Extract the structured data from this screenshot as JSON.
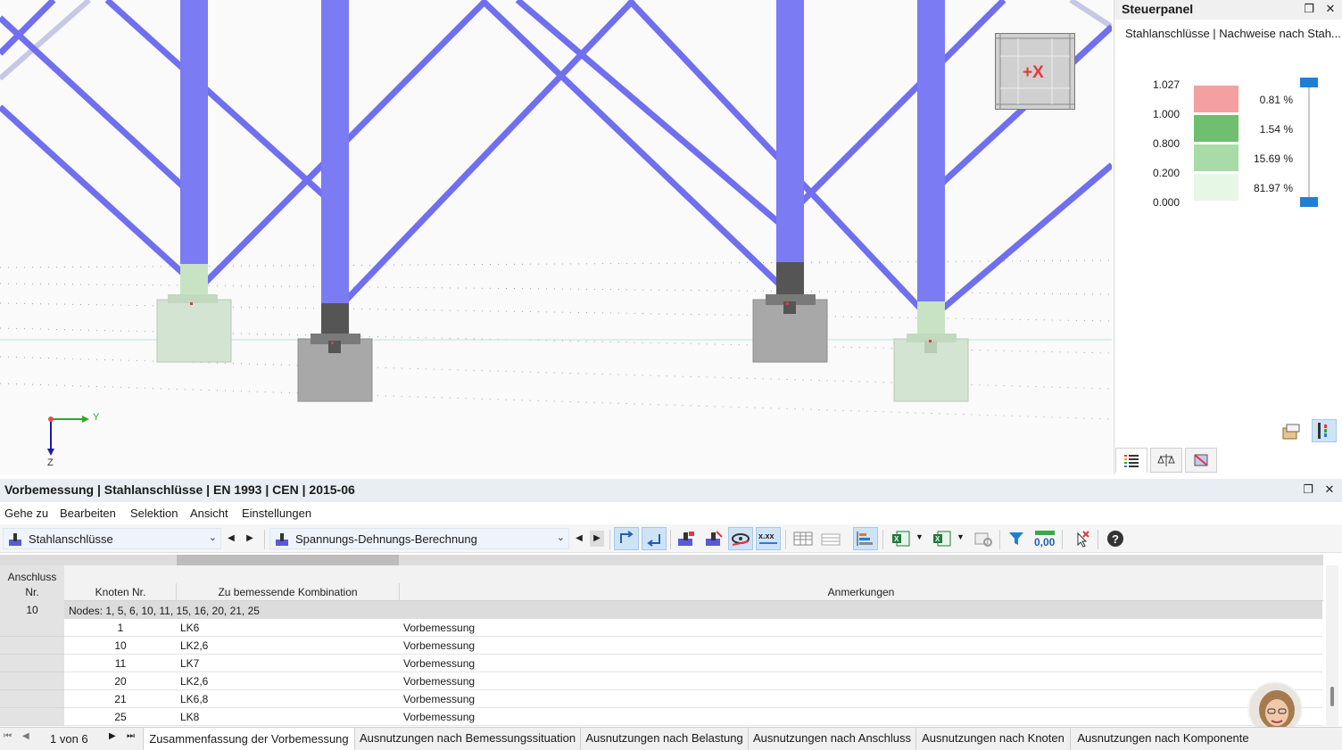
{
  "viewport": {
    "axis_y": "Y",
    "axis_z": "Z",
    "view_cube_label": "+X"
  },
  "panel": {
    "title": "Steuerpanel",
    "subtitle": "Stahlanschlüsse | Nachweise nach Stah...",
    "legend": {
      "values": [
        "1.027",
        "1.000",
        "0.800",
        "0.200",
        "0.000"
      ],
      "bands": [
        {
          "percent": "0.81 %",
          "color": "#f4a0a0"
        },
        {
          "percent": "1.54 %",
          "color": "#6fbf6f"
        },
        {
          "percent": "15.69 %",
          "color": "#a8dba8"
        },
        {
          "percent": "81.97 %",
          "color": "#e6f7e6"
        }
      ]
    }
  },
  "bottom": {
    "title": "Vorbemessung | Stahlanschlüsse | EN 1993 | CEN | 2015-06",
    "menu": [
      "Gehe zu",
      "Bearbeiten",
      "Selektion",
      "Ansicht",
      "Einstellungen"
    ],
    "combo1": "Stahlanschlüsse",
    "combo2": "Spannungs-Dehnungs-Berechnung",
    "table": {
      "headers": {
        "col1_line1": "Anschluss",
        "col1_line2": "Nr.",
        "col2": "Knoten Nr.",
        "col3": "Zu bemessende Kombination",
        "col4": "Anmerkungen"
      },
      "group": {
        "nr": "10",
        "nodes": "Nodes: 1, 5, 6, 10, 11, 15, 16, 20, 21, 25"
      },
      "rows": [
        {
          "node": "1",
          "combo": "LK6",
          "note": "Vorbemessung"
        },
        {
          "node": "10",
          "combo": "LK2,6",
          "note": "Vorbemessung"
        },
        {
          "node": "11",
          "combo": "LK7",
          "note": "Vorbemessung"
        },
        {
          "node": "20",
          "combo": "LK2,6",
          "note": "Vorbemessung"
        },
        {
          "node": "21",
          "combo": "LK6,8",
          "note": "Vorbemessung"
        },
        {
          "node": "25",
          "combo": "LK8",
          "note": "Vorbemessung"
        }
      ]
    },
    "pager": "1 von 6",
    "tabs": [
      "Zusammenfassung der Vorbemessung",
      "Ausnutzungen nach Bemessungssituation",
      "Ausnutzungen nach Belastung",
      "Ausnutzungen nach Anschluss",
      "Ausnutzungen nach Knoten",
      "Ausnutzungen nach Komponente"
    ]
  }
}
